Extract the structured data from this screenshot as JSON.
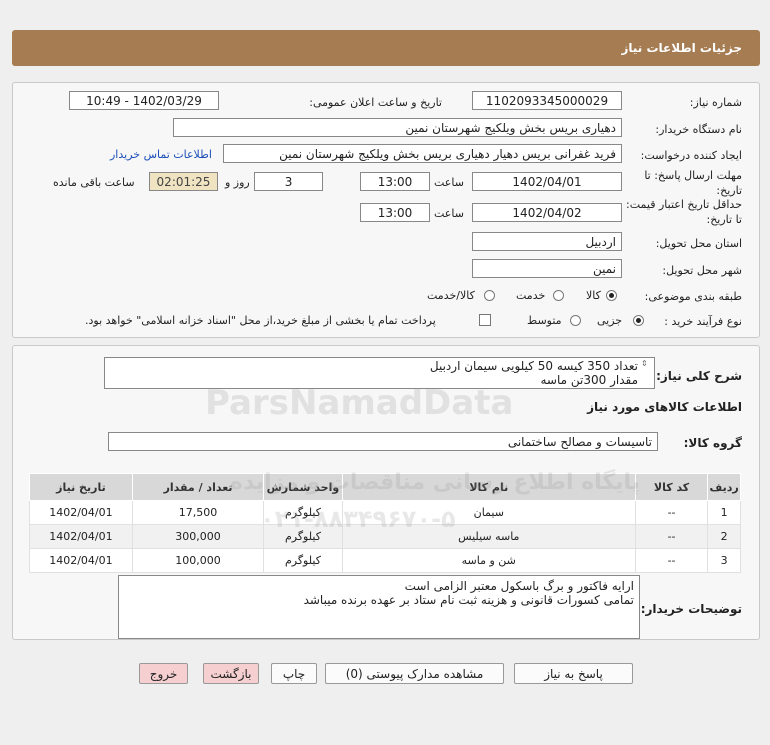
{
  "header": {
    "title": "جزئیات اطلاعات نیاز"
  },
  "form": {
    "need_number_label": "شماره نیاز:",
    "need_number": "1102093345000029",
    "announce_label": "تاریخ و ساعت اعلان عمومی:",
    "announce_value": "1402/03/29 - 10:49",
    "buyer_org_label": "نام دستگاه خریدار:",
    "buyer_org": "دهیاری بریس بخش ویلکیج شهرستان نمین",
    "creator_label": "ایجاد کننده درخواست:",
    "creator": "فرید غفرانی بریس دهیار دهیاری بریس بخش ویلکیج شهرستان نمین",
    "contact_link": "اطلاعات تماس خریدار",
    "reply_deadline_label": "مهلت ارسال پاسخ: تا تاریخ:",
    "reply_date": "1402/04/01",
    "time_label": "ساعت",
    "reply_time": "13:00",
    "days_value": "3",
    "days_label": "روز و",
    "remaining_time": "02:01:25",
    "remaining_label": "ساعت باقی مانده",
    "price_validity_label": "حداقل تاریخ اعتبار قیمت: تا تاریخ:",
    "price_date": "1402/04/02",
    "price_time": "13:00",
    "province_label": "استان محل تحویل:",
    "province": "اردبیل",
    "city_label": "شهر محل تحویل:",
    "city": "نمین",
    "category_label": "طبقه بندی موضوعی:",
    "category_options": [
      "کالا",
      "خدمت",
      "کالا/خدمت"
    ],
    "process_label": "نوع فرآیند خرید :",
    "process_options": [
      "جزیی",
      "متوسط"
    ],
    "payment_note": "پرداخت تمام یا بخشی از مبلغ خرید،از محل \"اسناد خزانه اسلامی\" خواهد بود."
  },
  "description": {
    "label": "شرح کلی نیاز:",
    "line1": "تعداد 350 کیسه 50 کیلویی سیمان اردبیل",
    "line2": "مقدار 300تن ماسه"
  },
  "goods": {
    "section_title": "اطلاعات کالاهای مورد نیاز",
    "group_label": "گروه کالا:",
    "group_value": "تاسیسات و مصالح ساختمانی",
    "columns": [
      "ردیف",
      "کد کالا",
      "نام کالا",
      "واحد شمارش",
      "تعداد / مقدار",
      "تاریخ نیاز"
    ],
    "rows": [
      [
        "1",
        "--",
        "سیمان",
        "کیلوگرم",
        "17,500",
        "1402/04/01"
      ],
      [
        "2",
        "--",
        "ماسه سیلیس",
        "کیلوگرم",
        "300,000",
        "1402/04/01"
      ],
      [
        "3",
        "--",
        "شن و ماسه",
        "کیلوگرم",
        "100,000",
        "1402/04/01"
      ]
    ]
  },
  "buyer_notes": {
    "label": "توضیحات خریدار:",
    "line1": "ارایه فاکتور و برگ باسکول معتبر الزامی است",
    "line2": "تمامی کسورات قانونی و هزینه ثبت نام ستاد بر عهده برنده میباشد"
  },
  "buttons": {
    "reply": "پاسخ به نیاز",
    "attachments": "مشاهده مدارک پیوستی (0)",
    "print": "چاپ",
    "back": "بازگشت",
    "exit": "خروج"
  },
  "watermark": {
    "brand": "ParsNamadData",
    "line_fa": "پایگاه اطلاع رسانی مناقصات و مزایده",
    "phone": "۰۲۱-۸۸۳۴۹۶۷۰-۵"
  }
}
